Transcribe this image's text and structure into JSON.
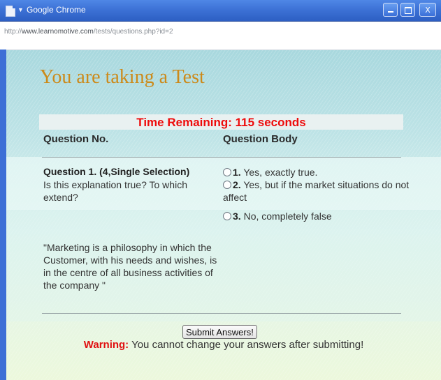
{
  "window": {
    "title": "Google Chrome",
    "url_prefix": "http://",
    "url_host": "www.learnomotive.com",
    "url_path": "/tests/questions.php?id=2",
    "controls": {
      "minimize_icon": "minimize-icon",
      "maximize_icon": "maximize-icon",
      "close_label": "X"
    }
  },
  "page": {
    "heading": "You are taking a Test",
    "timer": "Time Remaining: 115 seconds",
    "columns": [
      "Question No.",
      "Question Body"
    ],
    "question": {
      "title": "Question 1. (4,Single Selection)",
      "text": "Is this explanation true? To which extend?",
      "quote": "\"Marketing is a philosophy in which the Customer, with his needs and wishes, is in the centre of all business activities of the company \""
    },
    "options": [
      {
        "number": "1.",
        "text": " Yes, exactly true."
      },
      {
        "number": "2.",
        "text": " Yes, but if the market situations do not affect"
      },
      {
        "number": "3.",
        "text": " No, completely false"
      }
    ],
    "submit_label": "Submit Answers!",
    "warning_label": "Warning:",
    "warning_text": " You cannot change your answers after submitting!"
  },
  "colors": {
    "heading": "#cc8a1a",
    "timer": "#ee0c0c",
    "warning": "#e01010",
    "titlebar": "#3d72d6"
  }
}
